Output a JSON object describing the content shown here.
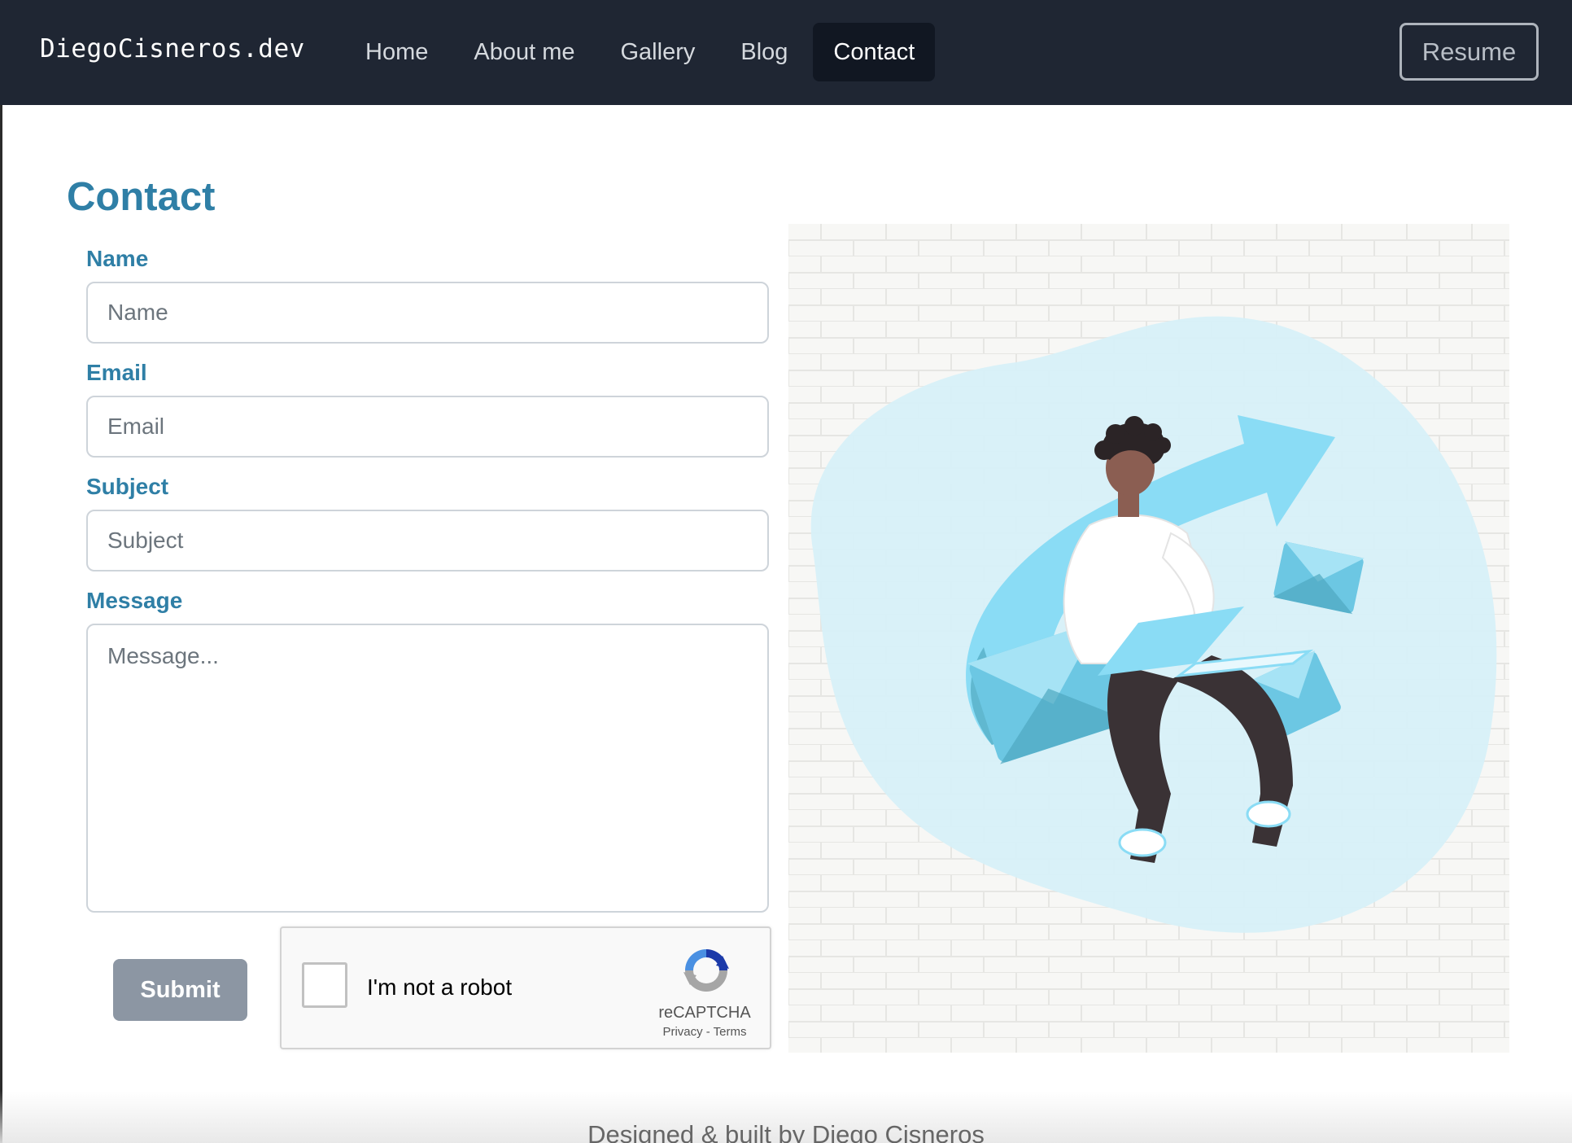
{
  "brand": "DiegoCisneros.dev",
  "nav": {
    "items": [
      {
        "label": "Home",
        "active": false
      },
      {
        "label": "About me",
        "active": false
      },
      {
        "label": "Gallery",
        "active": false
      },
      {
        "label": "Blog",
        "active": false
      },
      {
        "label": "Contact",
        "active": true
      }
    ],
    "resume_label": "Resume"
  },
  "page": {
    "title": "Contact"
  },
  "form": {
    "name": {
      "label": "Name",
      "placeholder": "Name",
      "value": ""
    },
    "email": {
      "label": "Email",
      "placeholder": "Email",
      "value": ""
    },
    "subject": {
      "label": "Subject",
      "placeholder": "Subject",
      "value": ""
    },
    "message": {
      "label": "Message",
      "placeholder": "Message...",
      "value": ""
    },
    "submit_label": "Submit"
  },
  "recaptcha": {
    "label": "I'm not a robot",
    "brand": "reCAPTCHA",
    "links": "Privacy - Terms",
    "checked": false
  },
  "illustration": {
    "icon": "person-laptop-envelopes-illustration"
  },
  "footer": {
    "text": "Designed & built by Diego Cisneros"
  },
  "colors": {
    "navbar": "#1f2633",
    "accent": "#2f7fa6",
    "submit": "#8c96a3",
    "illustration_blue": "#8adcf5"
  }
}
